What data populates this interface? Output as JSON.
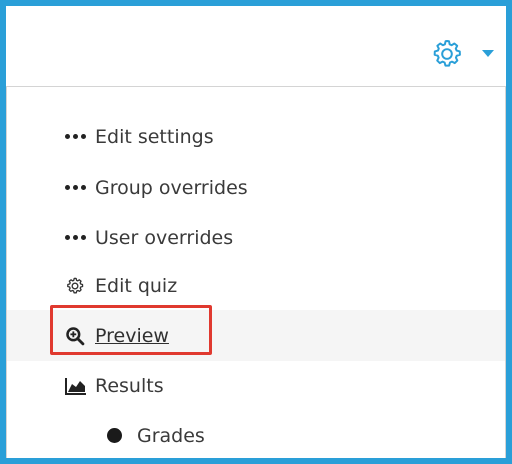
{
  "header": {
    "settings_icon": "gear-icon",
    "dropdown_icon": "caret-down-icon",
    "accent": "#2a9fd8"
  },
  "menu": {
    "items": [
      {
        "label": "Edit settings",
        "icon": "ellipsis-icon"
      },
      {
        "label": "Group overrides",
        "icon": "ellipsis-icon"
      },
      {
        "label": "User overrides",
        "icon": "ellipsis-icon"
      },
      {
        "label": "Edit quiz",
        "icon": "gear-icon"
      },
      {
        "label": "Preview",
        "icon": "zoom-in-icon",
        "highlighted": true
      },
      {
        "label": "Results",
        "icon": "area-chart-icon"
      },
      {
        "label": "Grades",
        "icon": "bullet-icon"
      }
    ]
  },
  "highlight_color": "#e0392f"
}
